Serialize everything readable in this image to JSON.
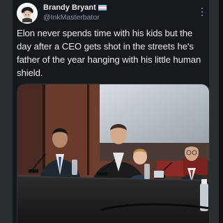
{
  "tweet": {
    "author_name": "Brandy Bryant",
    "author_handle": "@InkMasterbator",
    "text": "Elon never spends time with his kids but the day after a CEO gets shot in the streets he's father of the year hanging with his little human shield.",
    "flag_icon": "flag-icon",
    "more_icon": "more-options-icon"
  },
  "media": {
    "kind": "photo",
    "description_icon": "photo-image"
  },
  "colors": {
    "background": "#15181c",
    "text": "#e7e9ea",
    "muted": "#8b98a5",
    "border": "#2f3336"
  }
}
